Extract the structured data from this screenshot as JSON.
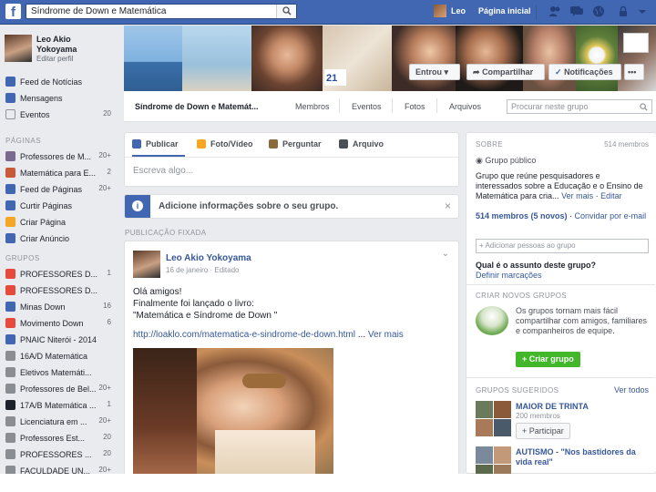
{
  "topbar": {
    "logo": "f",
    "search_value": "Síndrome de Down e Matemática",
    "user_name": "Leo",
    "home_label": "Página inicial"
  },
  "profile": {
    "name": "Leo Akio Yokoyama",
    "edit_label": "Editar perfil"
  },
  "nav": [
    {
      "label": "Feed de Notícias",
      "count": "",
      "icon": "news-feed-icon",
      "color": "#4267b2"
    },
    {
      "label": "Mensagens",
      "count": "",
      "icon": "messages-icon",
      "color": "#4267b2"
    },
    {
      "label": "Eventos",
      "count": "20",
      "icon": "calendar-icon",
      "color": "#e9ebee"
    }
  ],
  "pages_title": "PÁGINAS",
  "pages": [
    {
      "label": "Professores de M...",
      "count": "20+",
      "icon": "page-icon",
      "color": "#7a6a8f"
    },
    {
      "label": "Matemática para E...",
      "count": "2",
      "icon": "page-icon",
      "color": "#c85a3a"
    },
    {
      "label": "Feed de Páginas",
      "count": "20+",
      "icon": "pages-feed-icon",
      "color": "#4267b2"
    },
    {
      "label": "Curtir Páginas",
      "count": "",
      "icon": "like-pages-icon",
      "color": "#4267b2"
    },
    {
      "label": "Criar Página",
      "count": "",
      "icon": "create-page-icon",
      "color": "#f5a623"
    },
    {
      "label": "Criar Anúncio",
      "count": "",
      "icon": "create-ad-icon",
      "color": "#4267b2"
    }
  ],
  "groups_title": "GRUPOS",
  "groups": [
    {
      "label": "PROFESSORES D...",
      "count": "1",
      "icon": "group-icon",
      "color": "#e64a3c"
    },
    {
      "label": "PROFESSORES D...",
      "count": "",
      "icon": "group-icon",
      "color": "#e64a3c"
    },
    {
      "label": "Minas Down",
      "count": "16",
      "icon": "group-icon",
      "color": "#4267b2"
    },
    {
      "label": "Movimento Down",
      "count": "6",
      "icon": "group-icon",
      "color": "#e64a3c"
    },
    {
      "label": "PNAIC Niterói - 2014",
      "count": "",
      "icon": "group-icon",
      "color": "#4267b2"
    },
    {
      "label": "16A/D Matemática",
      "count": "",
      "icon": "group-icon",
      "color": "#8a8d91"
    },
    {
      "label": "Eletivos Matemáti...",
      "count": "",
      "icon": "group-icon",
      "color": "#8a8d91"
    },
    {
      "label": "Professores de Bel...",
      "count": "20+",
      "icon": "group-icon",
      "color": "#8a8d91"
    },
    {
      "label": "17A/B Matemática ...",
      "count": "1",
      "icon": "graduation-cap-icon",
      "color": "#1d2129"
    },
    {
      "label": "Licenciatura em ...",
      "count": "20+",
      "icon": "group-icon",
      "color": "#8a8d91"
    },
    {
      "label": "Professores Est...",
      "count": "20",
      "icon": "group-icon",
      "color": "#8a8d91"
    },
    {
      "label": "PROFESSORES ...",
      "count": "20",
      "icon": "group-icon",
      "color": "#8a8d91"
    },
    {
      "label": "FACULDADE UN...",
      "count": "20+",
      "icon": "group-icon",
      "color": "#8a8d91"
    }
  ],
  "cover": {
    "joined_label": "Entrou",
    "share_label": "Compartilhar",
    "notifications_label": "Notificações",
    "more_label": "•••"
  },
  "group_bar": {
    "name": "Síndrome de Down e Matemát...",
    "tabs": [
      "Membros",
      "Eventos",
      "Fotos",
      "Arquivos"
    ],
    "search_placeholder": "Procurar neste grupo"
  },
  "composer": {
    "tabs": [
      "Publicar",
      "Foto/Vídeo",
      "Perguntar",
      "Arquivo"
    ],
    "placeholder": "Escreva algo..."
  },
  "info_banner": "Adicione informações sobre o seu grupo.",
  "pinned_label": "PUBLICAÇÃO FIXADA",
  "post": {
    "author": "Leo Akio Yokoyama",
    "meta": "16 de janeiro · Editado",
    "lines": [
      "Olá amigos!",
      "Finalmente foi lançado o livro:",
      "\"Matemática e Síndrome de Down \""
    ],
    "link": "http://loaklo.com/matematica-e-sindrome-de-down.html",
    "see_more": "Ver mais"
  },
  "about": {
    "title": "SOBRE",
    "members": "514 membros",
    "privacy": "Grupo público",
    "description": "Grupo que reúne pesquisadores e interessados sobre a Educação e o Ensino de Matemática para cria...",
    "see_more": "Ver mais",
    "edit": "Editar",
    "members_line": "514 membros (5 novos)",
    "invite": "Convidar por e-mail",
    "add_placeholder": "+ Adicionar pessoas ao grupo",
    "question": "Qual é o assunto deste grupo?",
    "define_tags": "Definir marcações"
  },
  "create_groups": {
    "title": "CRIAR NOVOS GRUPOS",
    "text": "Os grupos tornam mais fácil compartilhar com amigos, familiares e companheiros de equipe.",
    "button": "+ Criar grupo"
  },
  "suggested": {
    "title": "GRUPOS SUGERIDOS",
    "see_all": "Ver todos",
    "items": [
      {
        "name": "MAIOR DE TRINTA",
        "members": "200 membros",
        "button": "+ Participar"
      },
      {
        "name": "AUTISMO - \"Nos bastidores da vida real\"",
        "members": ""
      }
    ]
  }
}
